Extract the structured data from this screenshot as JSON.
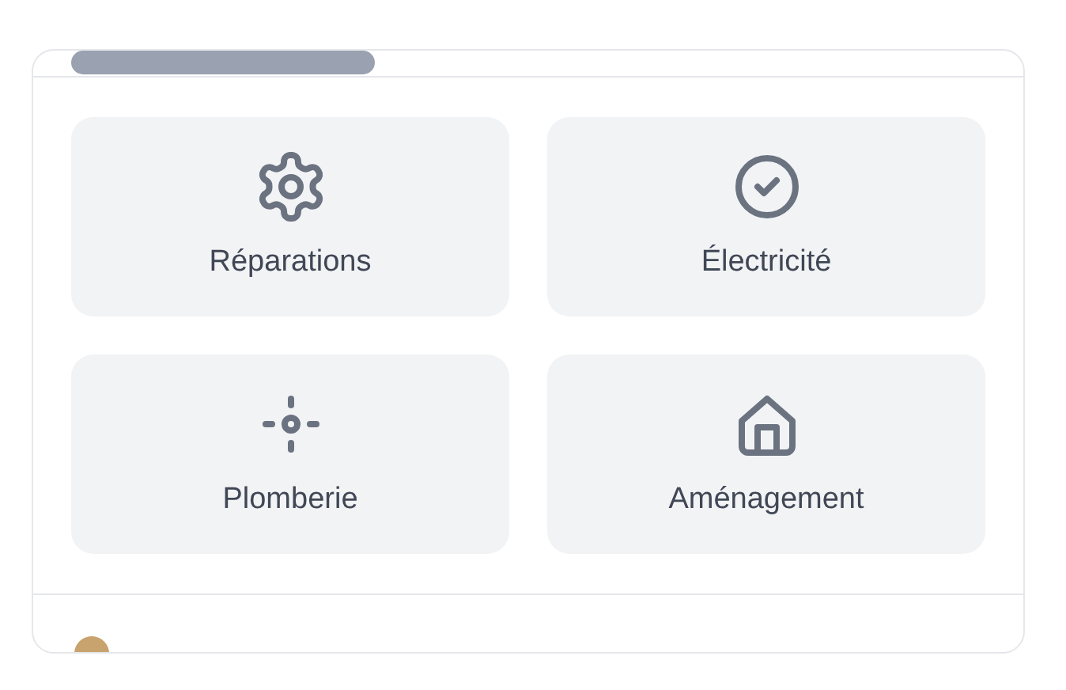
{
  "services": [
    {
      "label": "Réparations"
    },
    {
      "label": "Électricité"
    },
    {
      "label": "Plomberie"
    },
    {
      "label": "Aménagement"
    }
  ]
}
